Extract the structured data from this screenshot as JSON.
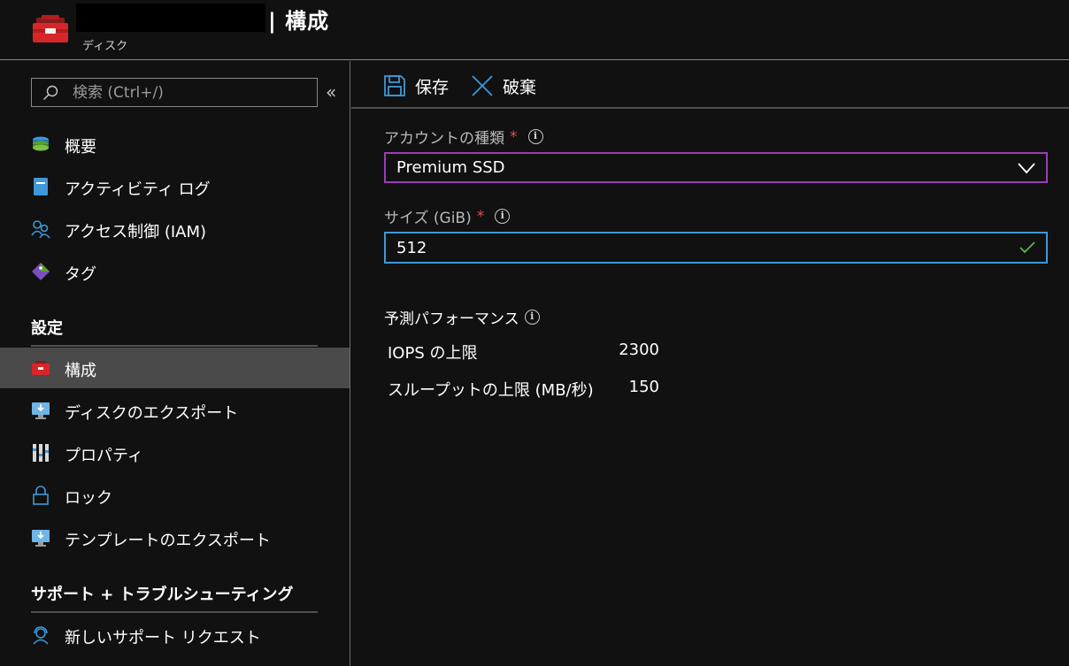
{
  "header": {
    "title": "| 構成",
    "subtitle": "ディスク"
  },
  "sidebar": {
    "search": {
      "placeholder": "検索 (Ctrl+/)",
      "value": ""
    },
    "collapse_glyph": "«",
    "items_general": [
      {
        "label": "概要",
        "icon": "overview-disk-icon"
      },
      {
        "label": "アクティビティ ログ",
        "icon": "activity-log-icon"
      },
      {
        "label": "アクセス制御 (IAM)",
        "icon": "iam-people-icon"
      },
      {
        "label": "タグ",
        "icon": "tag-icon"
      }
    ],
    "settings_header": "設定",
    "items_settings": [
      {
        "label": "構成",
        "icon": "configuration-toolbox-icon",
        "active": true
      },
      {
        "label": "ディスクのエクスポート",
        "icon": "disk-export-icon"
      },
      {
        "label": "プロパティ",
        "icon": "properties-icon"
      },
      {
        "label": "ロック",
        "icon": "lock-icon"
      },
      {
        "label": "テンプレートのエクスポート",
        "icon": "template-export-icon"
      }
    ],
    "support_header": "サポート + トラブルシューティング",
    "items_support": [
      {
        "label": "新しいサポート リクエスト",
        "icon": "support-request-icon"
      }
    ]
  },
  "toolbar": {
    "save_label": "保存",
    "discard_label": "破棄"
  },
  "form": {
    "account_type": {
      "label": "アカウントの種類",
      "required": "*",
      "value": "Premium SSD"
    },
    "size": {
      "label": "サイズ (GiB)",
      "required": "*",
      "value": "512"
    }
  },
  "performance": {
    "title": "予測パフォーマンス",
    "rows": [
      {
        "label": "IOPS の上限",
        "value": "2300"
      },
      {
        "label": "スループットの上限 (MB/秒)",
        "value": "150"
      }
    ]
  },
  "colors": {
    "background": "#111111",
    "active_nav": "#4a4a4a",
    "select_border": "#9b3db5",
    "input_border": "#3f98d8",
    "required": "#e05050",
    "valid_check": "#5bb84a",
    "accent_blue": "#3f98d8"
  }
}
